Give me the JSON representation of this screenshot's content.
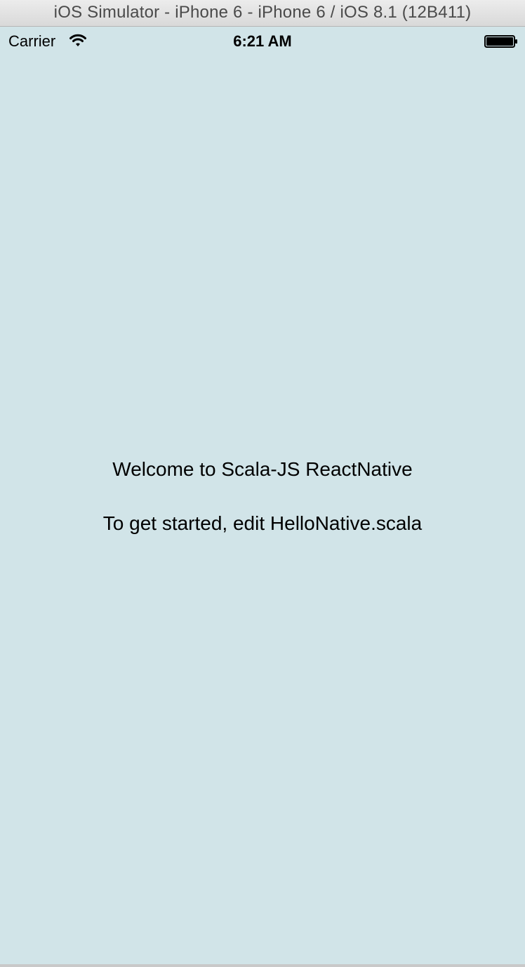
{
  "window": {
    "title": "iOS Simulator - iPhone 6 - iPhone 6 / iOS 8.1 (12B411)"
  },
  "status_bar": {
    "carrier": "Carrier",
    "time": "6:21 AM",
    "wifi_icon": "wifi-icon",
    "battery_icon": "battery-icon"
  },
  "screen": {
    "background_color": "#d1e4e8",
    "welcome": "Welcome to Scala-JS ReactNative",
    "instructions": "To get started, edit HelloNative.scala"
  }
}
